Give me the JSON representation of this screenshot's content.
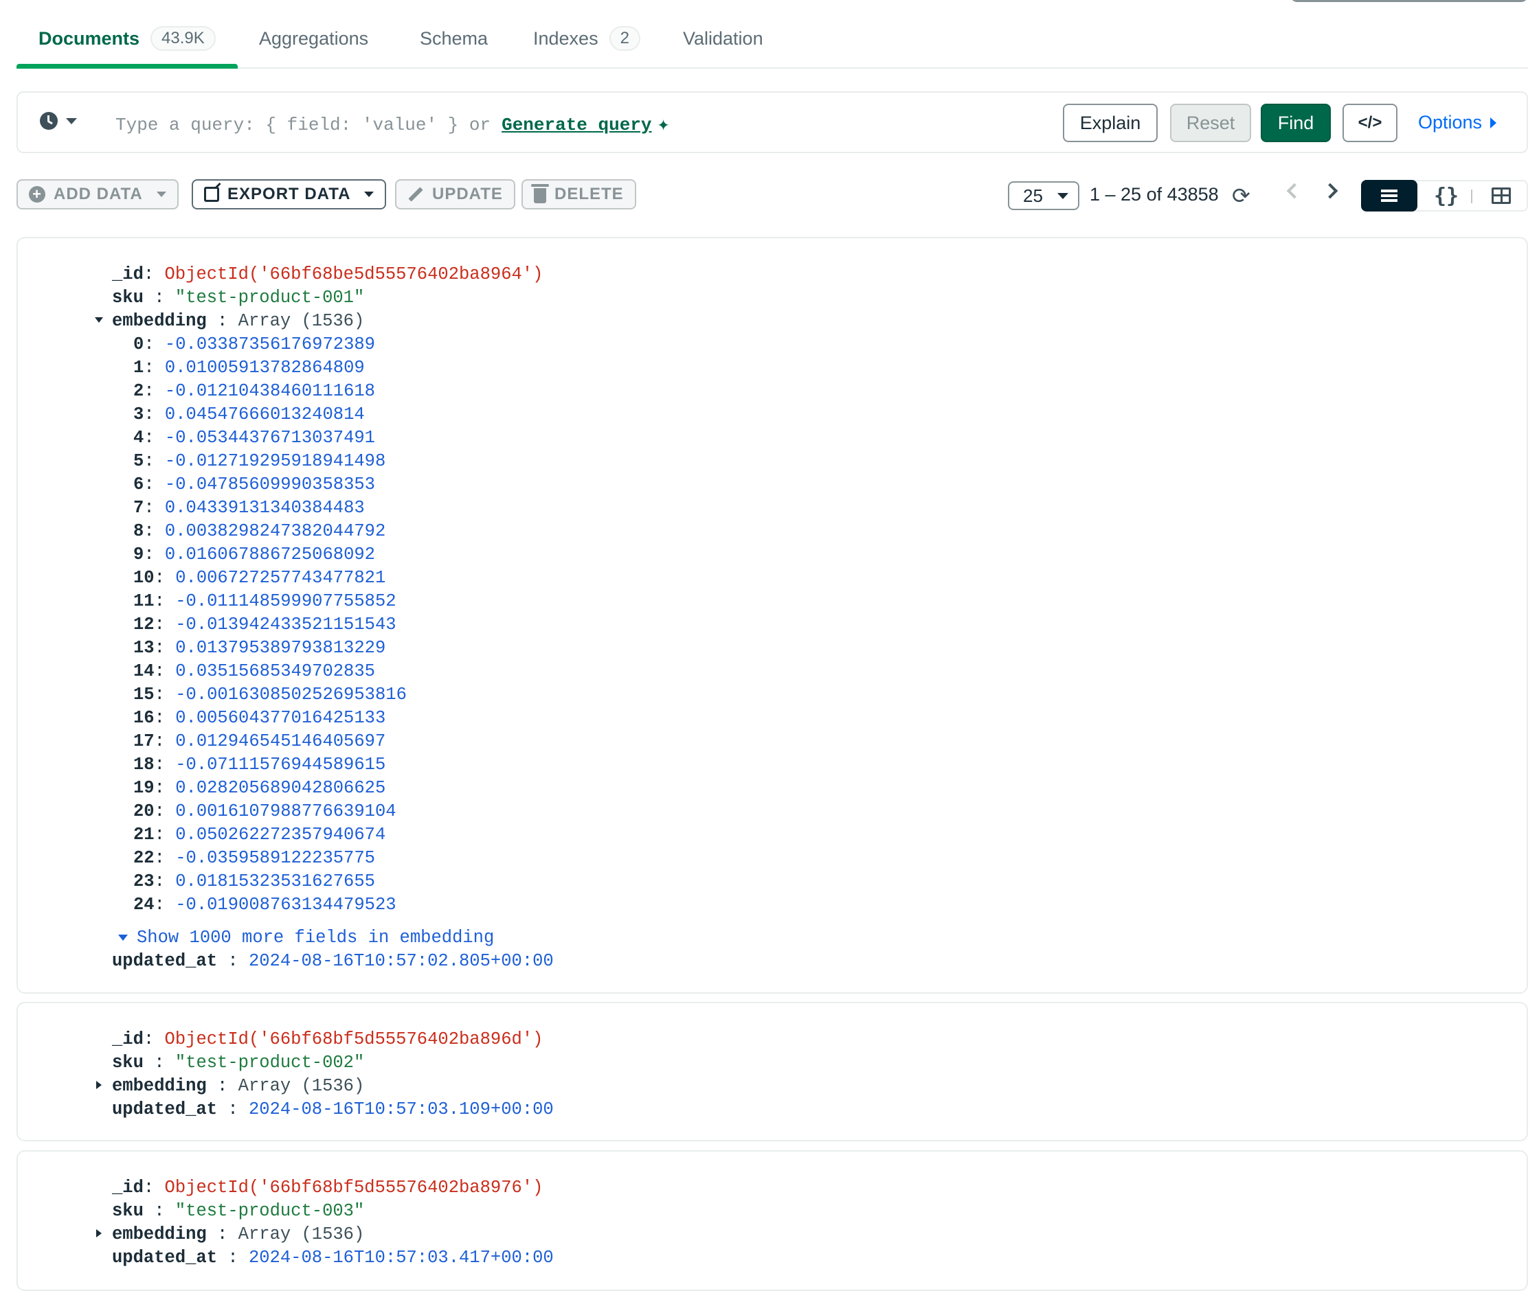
{
  "tabs": [
    {
      "label": "Documents",
      "badge": "43.9K"
    },
    {
      "label": "Aggregations"
    },
    {
      "label": "Schema"
    },
    {
      "label": "Indexes",
      "badge": "2"
    },
    {
      "label": "Validation"
    }
  ],
  "query": {
    "placeholder": "Type a query: { field: 'value' } or",
    "generate_link": "Generate query",
    "explain": "Explain",
    "reset": "Reset",
    "find": "Find",
    "code_icon": "</>",
    "options": "Options"
  },
  "toolbar": {
    "add_data": "ADD DATA",
    "export_data": "EXPORT DATA",
    "update": "UPDATE",
    "delete": "DELETE",
    "page_size": "25",
    "range": "1 – 25 of 43858",
    "json_icon": "{}"
  },
  "colors": {
    "accent": "#00684a",
    "tab_underline": "#00a35c",
    "objectid": "#c92e1c",
    "string": "#1e7a3f",
    "number": "#1e5fd6"
  },
  "documents": [
    {
      "id": "ObjectId('66bf68be5d55576402ba8964')",
      "sku": "\"test-product-001\"",
      "embedding_summary": "Array (1536)",
      "expanded": true,
      "embedding_values": [
        "-0.03387356176972389",
        "0.01005913782864809",
        "-0.01210438460111618",
        "0.04547666013240814",
        "-0.05344376713037491",
        "-0.012719295918941498",
        "-0.04785609990358353",
        "0.04339131340384483",
        "0.0038298247382044792",
        "0.016067886725068092",
        "0.006727257743477821",
        "-0.011148599907755852",
        "-0.013942433521151543",
        "0.013795389793813229",
        "0.03515685349702835",
        "-0.0016308502526953816",
        "0.005604377016425133",
        "0.012946545146405697",
        "-0.07111576944589615",
        "0.028205689042806625",
        "0.0016107988776639104",
        "0.050262272357940674",
        "-0.0359589122235775",
        "0.01815323531627655",
        "-0.019008763134479523"
      ],
      "show_more": "Show 1000 more fields in embedding",
      "updated_at": "2024-08-16T10:57:02.805+00:00"
    },
    {
      "id": "ObjectId('66bf68bf5d55576402ba896d')",
      "sku": "\"test-product-002\"",
      "embedding_summary": "Array (1536)",
      "expanded": false,
      "updated_at": "2024-08-16T10:57:03.109+00:00"
    },
    {
      "id": "ObjectId('66bf68bf5d55576402ba8976')",
      "sku": "\"test-product-003\"",
      "embedding_summary": "Array (1536)",
      "expanded": false,
      "updated_at": "2024-08-16T10:57:03.417+00:00"
    }
  ],
  "field_names": {
    "id": "_id",
    "sku": "sku",
    "embedding": "embedding",
    "updated_at": "updated_at"
  }
}
